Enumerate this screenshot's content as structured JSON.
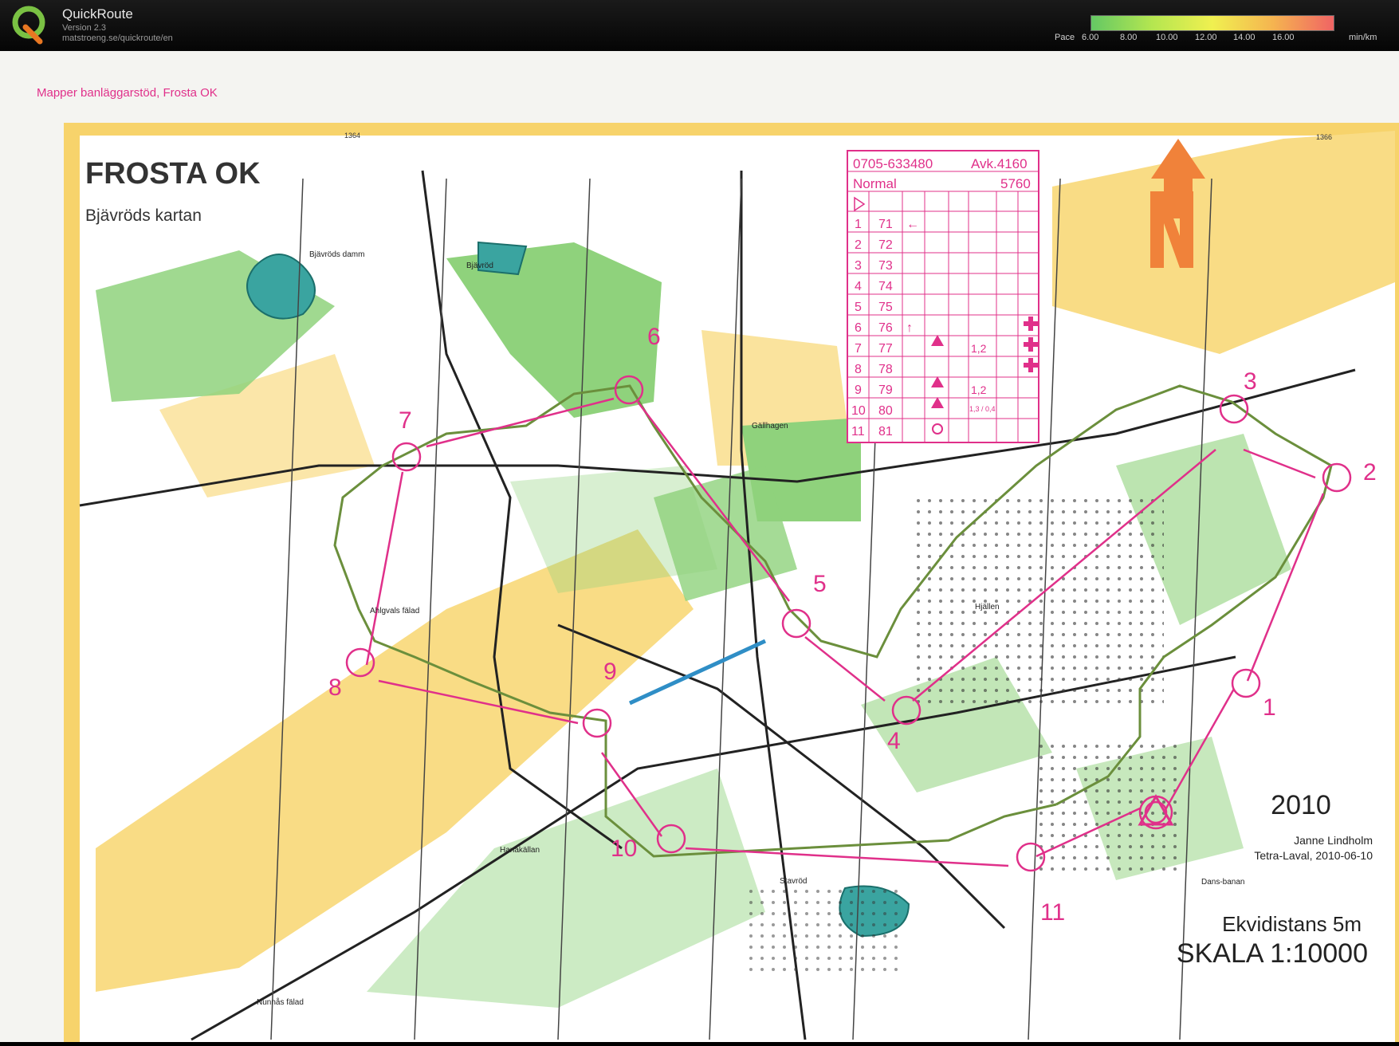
{
  "app": {
    "title": "QuickRoute",
    "version": "Version 2.3",
    "url": "matstroeng.se/quickroute/en"
  },
  "pace_scale": {
    "label": "Pace",
    "ticks": [
      "6.00",
      "8.00",
      "10.00",
      "12.00",
      "14.00",
      "16.00"
    ],
    "unit": "min/km",
    "gradient": [
      "#64c864",
      "#b4e650",
      "#f0f050",
      "#f5b450",
      "#f06464"
    ]
  },
  "map": {
    "mapper_credit": "Mapper banläggarstöd, Frosta OK",
    "club": "FROSTA OK",
    "map_name": "Bjävröds kartan",
    "year": "2010",
    "course_setter": "Janne Lindholm",
    "org_date": "Tetra-Laval, 2010-06-10",
    "contour_interval": "Ekvidistans 5m",
    "scale": "SKALA 1:10000",
    "place_names": [
      "Bjävröd",
      "Gällhagen",
      "Hjällen",
      "Stavröd",
      "Nunnås fälad",
      "Hanakällan",
      "Dans-banan",
      "Bjävröds damm",
      "Ahlgvals fälad"
    ],
    "margin_labels": [
      "1364",
      "1366"
    ],
    "control_numbers": [
      "1",
      "2",
      "3",
      "4",
      "5",
      "6",
      "7",
      "8",
      "9",
      "10",
      "11"
    ],
    "control_description": {
      "phone": "0705-633480",
      "course": "Avk.4160",
      "class": "Normal",
      "length": "5760",
      "rows": [
        {
          "n": "1",
          "code": "71",
          "d": "←",
          "f": "",
          "g": ""
        },
        {
          "n": "2",
          "code": "72",
          "d": "",
          "f": "",
          "g": ""
        },
        {
          "n": "3",
          "code": "73",
          "d": "",
          "f": "",
          "g": ""
        },
        {
          "n": "4",
          "code": "74",
          "d": "",
          "f": "",
          "g": ""
        },
        {
          "n": "5",
          "code": "75",
          "d": "",
          "f": "",
          "g": ""
        },
        {
          "n": "6",
          "code": "76",
          "d": "↑",
          "f": "",
          "g": ""
        },
        {
          "n": "7",
          "code": "77",
          "d": "",
          "f": "1,2",
          "g": ""
        },
        {
          "n": "8",
          "code": "78",
          "d": "",
          "f": "",
          "g": ""
        },
        {
          "n": "9",
          "code": "79",
          "d": "",
          "f": "1,2",
          "g": ""
        },
        {
          "n": "10",
          "code": "80",
          "d": "",
          "f": "1,3 / 0,4",
          "g": ""
        },
        {
          "n": "11",
          "code": "81",
          "d": "",
          "f": "",
          "g": ""
        }
      ]
    },
    "colors": {
      "course": "#e0308a",
      "route": "#6b8f3c",
      "forest": "#ffffff",
      "open": "#f7d36b",
      "green": "#7cc86a",
      "water": "#3aa4a0",
      "north_arrow": "#f0823a"
    }
  }
}
